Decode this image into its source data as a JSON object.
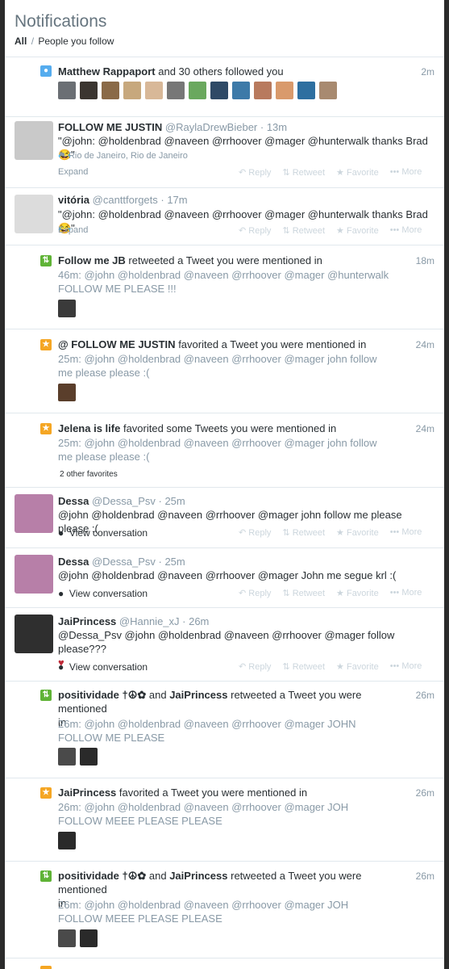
{
  "header": {
    "title": "Notifications",
    "tab_all": "All",
    "separator": "/",
    "tab_people": "People you follow"
  },
  "actions": {
    "reply": "Reply",
    "retweet": "Retweet",
    "favorite": "Favorite",
    "more": "More"
  },
  "n1": {
    "name": "Matthew Rappaport",
    "text": "and 30 others followed you",
    "time": "2m"
  },
  "n2": {
    "name": "FOLLOW ME JUSTIN",
    "handle": "@RaylaDrewBieber",
    "time": "· 13m",
    "text": "\"@john: @holdenbrad @naveen @rrhoover @mager @hunterwalk thanks Brad 😂\"",
    "location": "Rio de Janeiro, Rio de Janeiro",
    "expand": "Expand"
  },
  "n3": {
    "name": "vitória",
    "handle": "@canttforgets",
    "time": "· 17m",
    "text": "\"@john: @holdenbrad @naveen @rrhoover @mager @hunterwalk thanks Brad 😂\"",
    "expand": "Expand"
  },
  "n4": {
    "name": "Follow me JB",
    "text": "retweeted a Tweet you were mentioned in",
    "time": "18m",
    "quote1": "46m: @john @holdenbrad @naveen @rrhoover @mager @hunterwalk",
    "quote2": "FOLLOW ME PLEASE !!!"
  },
  "n5": {
    "name": "@ FOLLOW ME JUSTIN",
    "text": "favorited a Tweet you were mentioned in",
    "time": "24m",
    "quote1": "25m: @john @holdenbrad @naveen @rrhoover @mager john follow",
    "quote2": "me please please :("
  },
  "n6": {
    "name": "Jelena is life",
    "text": "favorited some Tweets you were mentioned in",
    "time": "24m",
    "quote1": "25m: @john @holdenbrad @naveen @rrhoover @mager john follow",
    "quote2": "me please please :(",
    "extra": "2 other favorites"
  },
  "n7": {
    "name": "Dessa",
    "handle": "@Dessa_Psv",
    "time": "· 25m",
    "text": "@john @holdenbrad @naveen @rrhoover @mager john follow me please please :(",
    "conv": "View conversation"
  },
  "n8": {
    "name": "Dessa",
    "handle": "@Dessa_Psv",
    "time": "· 25m",
    "text": "@john @holdenbrad @naveen @rrhoover @mager John me segue krl :(",
    "conv": "View conversation"
  },
  "n9": {
    "name": "JaiPrincess",
    "handle": "@Hannie_xJ",
    "time": "· 26m",
    "text": "@Dessa_Psv @john @holdenbrad @naveen @rrhoover @mager follow please???",
    "heart": "♥",
    "conv": "View conversation"
  },
  "n10": {
    "name1": "positividade †☮✿",
    "and": "and",
    "name2": "JaiPrincess",
    "text": "retweeted a Tweet you were mentioned",
    "text2": "in",
    "time": "26m",
    "quote1": "26m: @john @holdenbrad @naveen @rrhoover @mager  JOHN",
    "quote2": "FOLLOW ME PLEASE"
  },
  "n11": {
    "name": "JaiPrincess",
    "text": "favorited a Tweet you were mentioned in",
    "time": "26m",
    "quote1": "26m: @john @holdenbrad @naveen @rrhoover @mager JOH",
    "quote2": "FOLLOW MEEE PLEASE PLEASE"
  },
  "n12": {
    "name1": "positividade †☮✿",
    "and": "and",
    "name2": "JaiPrincess",
    "text": "retweeted a Tweet you were mentioned",
    "text2": "in",
    "time": "26m",
    "quote1": "26m: @john @holdenbrad @naveen @rrhoover @mager JOH",
    "quote2": "FOLLOW MEEE PLEASE PLEASE"
  }
}
